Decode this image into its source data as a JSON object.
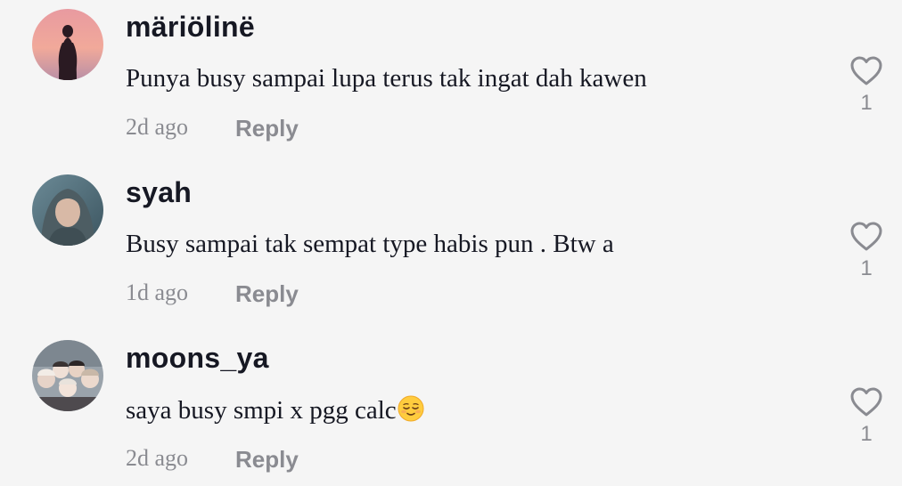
{
  "comments": [
    {
      "username": "märiölinë",
      "text": "Punya busy sampai lupa terus tak ingat dah kawen",
      "time": "2d ago",
      "reply_label": "Reply",
      "likes": "1",
      "avatar_icon": "sunset-silhouette-avatar"
    },
    {
      "username": "syah",
      "text": "Busy sampai tak sempat type habis pun . Btw a",
      "time": "1d ago",
      "reply_label": "Reply",
      "likes": "1",
      "avatar_icon": "hijab-portrait-avatar"
    },
    {
      "username": "moons_ya",
      "text": "saya busy smpi x pgg calc",
      "emoji": "relieved-face-emoji",
      "time": "2d ago",
      "reply_label": "Reply",
      "likes": "1",
      "avatar_icon": "group-photo-avatar"
    }
  ],
  "colors": {
    "background": "#f5f5f5",
    "primary_text": "#161823",
    "secondary_text": "#8a8b91"
  }
}
